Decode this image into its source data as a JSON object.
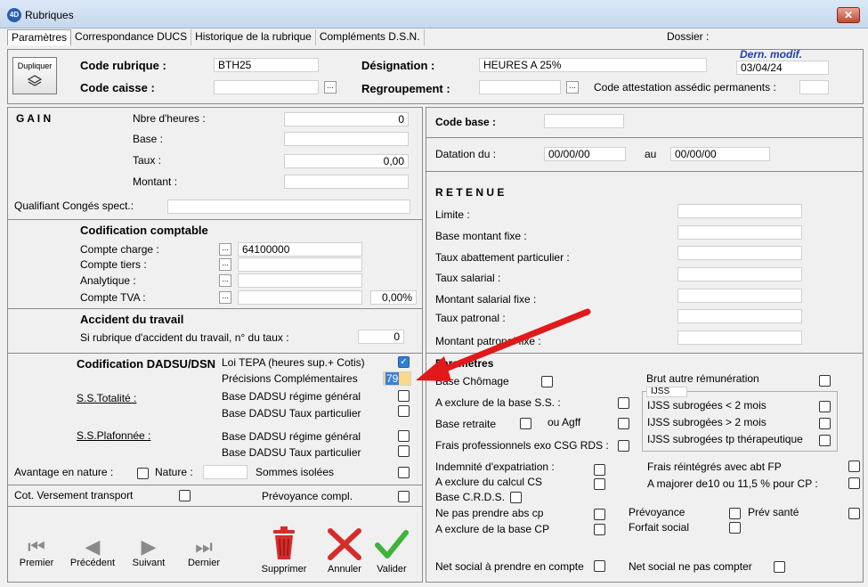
{
  "window": {
    "title": "Rubriques",
    "icon_text": "4D",
    "close_label": "✕"
  },
  "tabs": [
    "Paramètres",
    "Correspondance DUCS",
    "Historique de la rubrique",
    "Compléments D.S.N."
  ],
  "dossier_label": "Dossier :",
  "header": {
    "dupliquer": "Dupliquer",
    "code_rubrique_label": "Code rubrique :",
    "code_rubrique_value": "BTH25",
    "designation_label": "Désignation :",
    "designation_value": "HEURES A 25%",
    "dern_modif_label": "Dern. modif.",
    "dern_modif_value": "03/04/24",
    "code_caisse_label": "Code caisse :",
    "code_caisse_value": "",
    "regroupement_label": "Regroupement :",
    "regroupement_value": "",
    "attestation_label": "Code attestation assédic permanents :",
    "attestation_value": "",
    "dots": "..."
  },
  "gain": {
    "title": "G A I N",
    "nbre_heures_label": "Nbre d'heures :",
    "nbre_heures_value": "0",
    "base_label": "Base :",
    "base_value": "",
    "taux_label": "Taux  :",
    "taux_value": "0,00",
    "montant_label": "Montant :",
    "montant_value": "",
    "qualifiant_label": "Qualifiant Congés spect.:",
    "qualifiant_value": ""
  },
  "codification": {
    "title": "Codification comptable",
    "compte_charge_label": "Compte charge :",
    "compte_charge_value": "64100000",
    "compte_tiers_label": "Compte tiers :",
    "compte_tiers_value": "",
    "analytique_label": "Analytique :",
    "analytique_value": "",
    "compte_tva_label": "Compte TVA :",
    "compte_tva_value": "",
    "tva_rate": "0,00%"
  },
  "accident": {
    "title": "Accident du travail",
    "label": "Si rubrique d'accident du travail, n° du taux :",
    "value": "0"
  },
  "dadsu": {
    "title": "Codification DADSU/DSN",
    "loi_tepa": "Loi TEPA (heures sup.+ Cotis)",
    "precisions": "Précisions Complémentaires",
    "precisions_value": "79",
    "ss_totalite": "S.S.Totalité :",
    "base_general_1": "Base DADSU régime général",
    "base_taux_1": "Base DADSU Taux particulier",
    "ss_plafonnee": "S.S.Plafonnée :",
    "base_general_2": "Base DADSU régime général",
    "base_taux_2": "Base DADSU Taux particulier",
    "avantage_label": "Avantage en nature :",
    "nature_label": "Nature :",
    "nature_value": "",
    "sommes_isolees": "Sommes isolées"
  },
  "bottom_left": {
    "cot_transport": "Cot. Versement transport",
    "prevoyance_compl": "Prévoyance compl."
  },
  "nav": {
    "premier": "Premier",
    "precedent": "Précédent",
    "suivant": "Suivant",
    "dernier": "Dernier",
    "supprimer": "Supprimer",
    "annuler": "Annuler",
    "valider": "Valider"
  },
  "right": {
    "code_base_label": "Code base  :",
    "code_base_value": "",
    "datation_label": "Datation du :",
    "datation_from": "00/00/00",
    "au_label": "au",
    "datation_to": "00/00/00",
    "retenue_title": "R E T E N U E",
    "limite": "Limite :",
    "base_montant_fixe": "Base montant fixe :",
    "taux_abattement": "Taux abattement particulier :",
    "taux_salarial": "Taux salarial :",
    "montant_salarial_fixe": "Montant salarial fixe :",
    "taux_patronal": "Taux patronal :",
    "montant_patronal_fixe": "Montant patronal fixe :"
  },
  "parametres": {
    "title": "Paramètres",
    "base_chomage": "Base Chômage",
    "brut_autre": "Brut autre rémunération",
    "ijss_group": "IJSS",
    "a_exclure_ss": "A exclure de la base S.S. :",
    "ijss_lt2": "IJSS subrogées < 2 mois",
    "base_retraite": "Base retraite",
    "ou_agff": "ou Agff",
    "ijss_gt2": "IJSS subrogées > 2 mois",
    "frais_pro": "Frais professionnels exo CSG RDS :",
    "ijss_tp": "IJSS subrogées tp thérapeutique",
    "indemnite_expat": "Indemnité d'expatriation :",
    "frais_reintegres": "Frais réintégrés avec abt FP",
    "a_exclure_cs": "A exclure du calcul CS",
    "a_majorer": "A majorer de10 ou 11,5 % pour CP :",
    "base_crds": "Base C.R.D.S.",
    "ne_pas_prendre": "Ne pas prendre abs cp",
    "prevoyance": "Prévoyance",
    "prev_sante": "Prév santé",
    "a_exclure_cp": "A exclure de la base CP",
    "forfait_social": "Forfait social",
    "net_social_prendre": "Net social à prendre en compte",
    "net_social_ne_pas": "Net social ne pas compter"
  },
  "colors": {
    "arrow": "#e0191b",
    "delete": "#d62b2b",
    "check": "#3fb33a",
    "checked_box": "#2e7fd4",
    "highlight": "#fbd88a"
  }
}
